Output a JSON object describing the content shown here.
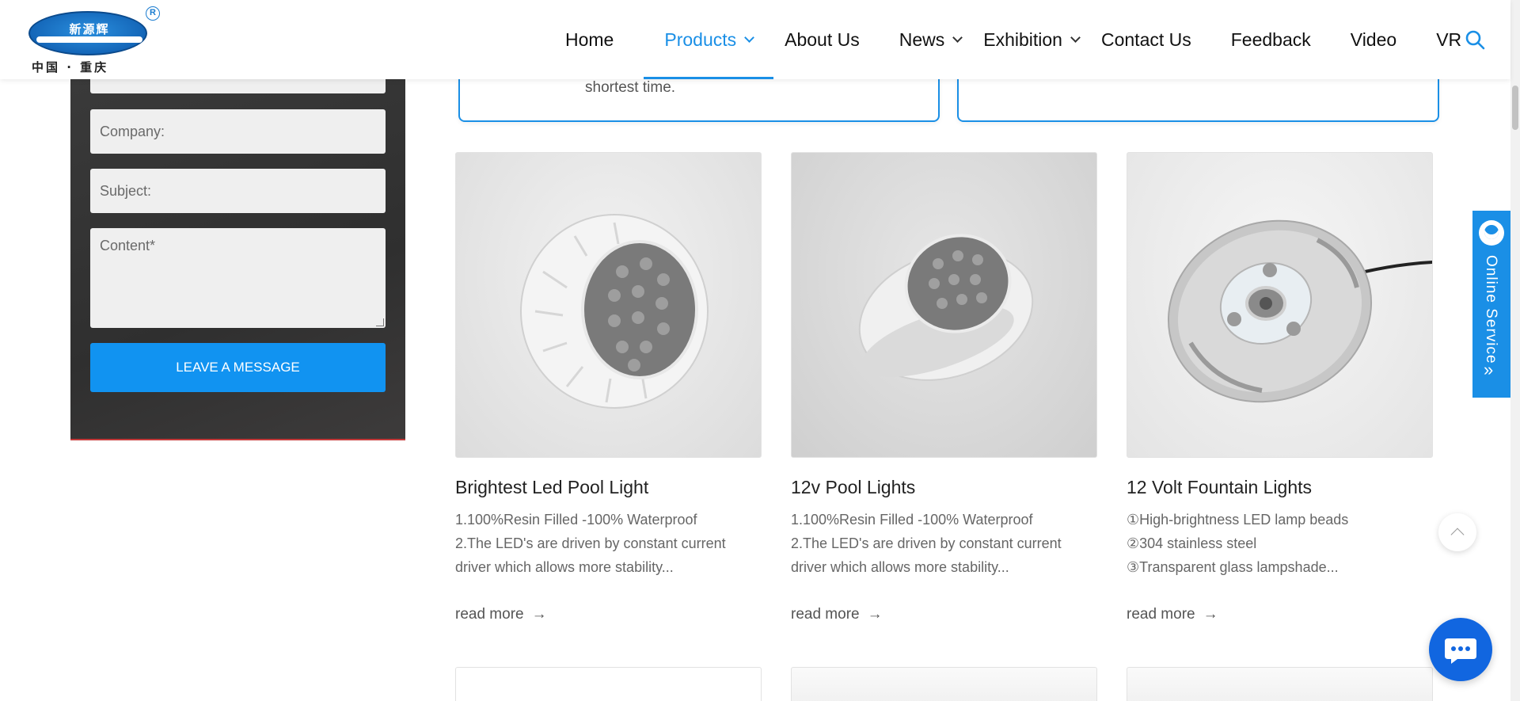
{
  "brand": {
    "logo_cn": "新源辉",
    "logo_registered": "R",
    "logo_sub": "中国 · 重庆"
  },
  "nav": {
    "items": [
      {
        "label": "Home",
        "dropdown": false,
        "active": false
      },
      {
        "label": "Products",
        "dropdown": true,
        "active": true
      },
      {
        "label": "About Us",
        "dropdown": false,
        "active": false
      },
      {
        "label": "News",
        "dropdown": true,
        "active": false
      },
      {
        "label": "Exhibition",
        "dropdown": true,
        "active": false
      },
      {
        "label": "Contact Us",
        "dropdown": false,
        "active": false
      },
      {
        "label": "Feedback",
        "dropdown": false,
        "active": false
      },
      {
        "label": "Video",
        "dropdown": false,
        "active": false
      },
      {
        "label": "VR",
        "dropdown": false,
        "active": false
      }
    ],
    "search_icon": "search-icon"
  },
  "form": {
    "company_placeholder": "Company:",
    "subject_placeholder": "Subject:",
    "content_placeholder": "Content*",
    "submit_label": "LEAVE A MESSAGE"
  },
  "features": {
    "left_text": "shortest time."
  },
  "products": [
    {
      "title": "Brightest Led Pool Light",
      "desc": [
        "1.100%Resin Filled -100% Waterproof",
        "2.The LED's are driven by constant current",
        "driver which allows more stability..."
      ],
      "more": "read more",
      "arrow": "→"
    },
    {
      "title": "12v Pool Lights",
      "desc": [
        "1.100%Resin Filled -100% Waterproof",
        "2.The LED's are driven by constant current",
        "driver which allows more stability..."
      ],
      "more": "read more",
      "arrow": "→"
    },
    {
      "title": "12 Volt Fountain Lights",
      "desc": [
        "①High-brightness LED lamp beads",
        "②304 stainless steel",
        "③Transparent glass lampshade..."
      ],
      "more": "read more",
      "arrow": "→"
    }
  ],
  "service": {
    "label": "Online Service",
    "chevron": "»"
  },
  "colors": {
    "accent": "#1a8fe6",
    "button": "#1193f1",
    "chat": "#1166e0"
  }
}
